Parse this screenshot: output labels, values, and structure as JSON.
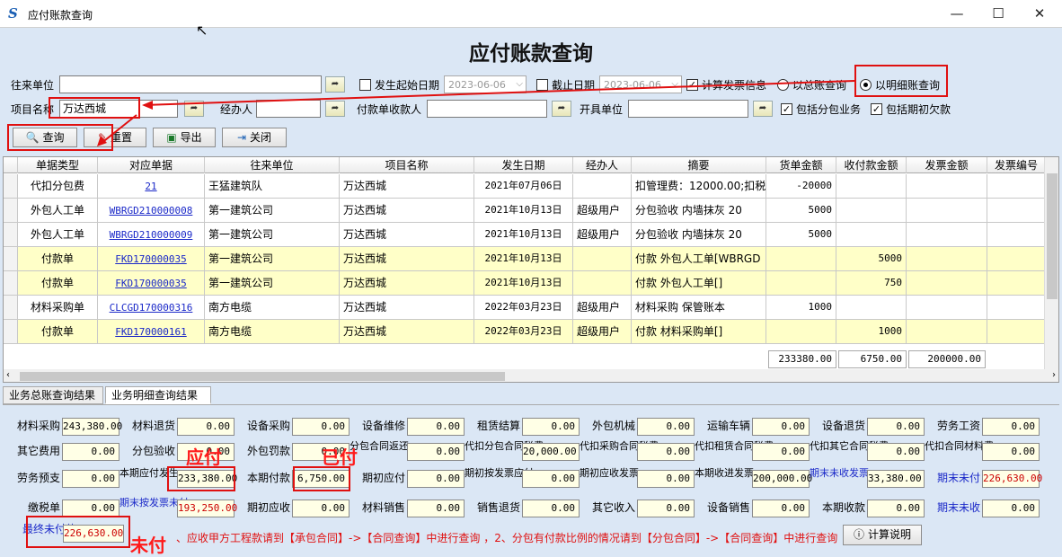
{
  "window": {
    "title": "应付账款查询",
    "heading": "应付账款查询"
  },
  "filters": {
    "partner_label": "往来单位",
    "partner_value": "",
    "start_date_label": "发生起始日期",
    "start_date": "2023-06-06",
    "start_checked": false,
    "end_date_label": "截止日期",
    "end_date": "2023-06-06",
    "end_checked": false,
    "calc_invoice_label": "计算发票信息",
    "calc_invoice_checked": true,
    "summary_radio_label": "以总账查询",
    "detail_radio_label": "以明细账查询",
    "mode": "detail",
    "project_label": "项目名称",
    "project_value": "万达西城",
    "handler_label": "经办人",
    "handler_value": "",
    "payee_label": "付款单收款人",
    "payee_value": "",
    "issuer_label": "开具单位",
    "issuer_value": "",
    "include_sub_label": "包括分包业务",
    "include_sub_checked": true,
    "include_opening_label": "包括期初欠款",
    "include_opening_checked": true
  },
  "buttons": {
    "query": "查询",
    "reset": "重置",
    "export": "导出",
    "close": "关闭",
    "calc_explain": "计算说明"
  },
  "table": {
    "columns": [
      "单据类型",
      "对应单据",
      "往来单位",
      "项目名称",
      "发生日期",
      "经办人",
      "摘要",
      "货单金额",
      "收付款金额",
      "发票金额",
      "发票编号"
    ],
    "rows": [
      {
        "type": "代扣分包费",
        "doc": "21",
        "partner": "王猛建筑队",
        "project": "万达西城",
        "date": "2021年07月06日",
        "handler": "",
        "summary": "扣管理费：12000.00;扣税",
        "goods": "-20000",
        "paid": "",
        "invoice": "",
        "hl": false
      },
      {
        "type": "外包人工单",
        "doc": "WBRGD210000008",
        "partner": "第一建筑公司",
        "project": "万达西城",
        "date": "2021年10月13日",
        "handler": "超级用户",
        "summary": "分包验收  内墙抹灰  20",
        "goods": "5000",
        "paid": "",
        "invoice": "",
        "hl": false
      },
      {
        "type": "外包人工单",
        "doc": "WBRGD210000009",
        "partner": "第一建筑公司",
        "project": "万达西城",
        "date": "2021年10月13日",
        "handler": "超级用户",
        "summary": "分包验收  内墙抹灰  20",
        "goods": "5000",
        "paid": "",
        "invoice": "",
        "hl": false
      },
      {
        "type": "付款单",
        "doc": "FKD170000035",
        "partner": "第一建筑公司",
        "project": "万达西城",
        "date": "2021年10月13日",
        "handler": "",
        "summary": "付款  外包人工单[WBRGD",
        "goods": "",
        "paid": "5000",
        "invoice": "",
        "hl": true
      },
      {
        "type": "付款单",
        "doc": "FKD170000035",
        "partner": "第一建筑公司",
        "project": "万达西城",
        "date": "2021年10月13日",
        "handler": "",
        "summary": "付款  外包人工单[]",
        "goods": "",
        "paid": "750",
        "invoice": "",
        "hl": true
      },
      {
        "type": "材料采购单",
        "doc": "CLCGD170000316",
        "partner": "南方电缆",
        "project": "万达西城",
        "date": "2022年03月23日",
        "handler": "超级用户",
        "summary": "材料采购  保管账本",
        "goods": "1000",
        "paid": "",
        "invoice": "",
        "hl": false
      },
      {
        "type": "付款单",
        "doc": "FKD170000161",
        "partner": "南方电缆",
        "project": "万达西城",
        "date": "2022年03月23日",
        "handler": "超级用户",
        "summary": "付款  材料采购单[]",
        "goods": "",
        "paid": "1000",
        "invoice": "",
        "hl": true
      }
    ],
    "totals": {
      "goods": "233380.00",
      "paid": "6750.00",
      "invoice": "200000.00"
    }
  },
  "tabs": [
    "业务总账查询结果",
    "业务明细查询结果"
  ],
  "summary": {
    "row1": [
      [
        "材料采购",
        "243,380.00"
      ],
      [
        "材料退货",
        "0.00"
      ],
      [
        "设备采购",
        "0.00"
      ],
      [
        "设备维修",
        "0.00"
      ],
      [
        "租赁结算",
        "0.00"
      ],
      [
        "外包机械",
        "0.00"
      ],
      [
        "运输车辆",
        "0.00"
      ],
      [
        "设备退货",
        "0.00"
      ],
      [
        "劳务工资",
        "0.00"
      ]
    ],
    "row2": [
      [
        "其它费用",
        "0.00"
      ],
      [
        "分包验收",
        "0.00"
      ],
      [
        "外包罚款",
        "0.00"
      ],
      [
        "分包合同返还",
        "0.00"
      ],
      [
        "代扣分包合同税费",
        "20,000.00"
      ],
      [
        "代扣采购合同税费",
        "0.00"
      ],
      [
        "代扣租赁合同税费",
        "0.00"
      ],
      [
        "代扣其它合同税费",
        "0.00"
      ],
      [
        "代扣合同材料费",
        "0.00"
      ]
    ],
    "row3": [
      [
        "劳务预支",
        "0.00"
      ],
      [
        "本期应付发生",
        "233,380.00"
      ],
      [
        "本期付款",
        "6,750.00"
      ],
      [
        "期初应付",
        "0.00"
      ],
      [
        "期初按发票应付",
        "0.00"
      ],
      [
        "期初应收发票",
        "0.00"
      ],
      [
        "本期收进发票",
        "200,000.00"
      ],
      [
        "期末未收发票",
        "33,380.00"
      ],
      [
        "期末未付",
        "226,630.00"
      ]
    ],
    "row4": [
      [
        "缴税单",
        "0.00"
      ],
      [
        "期末按发票未付",
        "193,250.00"
      ],
      [
        "期初应收",
        "0.00"
      ],
      [
        "材料销售",
        "0.00"
      ],
      [
        "销售退货",
        "0.00"
      ],
      [
        "其它收入",
        "0.00"
      ],
      [
        "设备销售",
        "0.00"
      ],
      [
        "本期收款",
        "0.00"
      ],
      [
        "期末未收",
        "0.00"
      ]
    ],
    "final_label": "最终未付款",
    "final_value": "226,630.00"
  },
  "annotations": {
    "yingfu": "应付",
    "yifu": "已付",
    "weifu": "未付"
  },
  "note": "、应收甲方工程款请到【承包合同】->【合同查询】中进行查询 ，2、分包有付款比例的情况请到【分包合同】->【合同查询】中进行查询",
  "colors": {
    "highlight_row": "#ffffc8",
    "link": "#1a28c8",
    "annotation": "#ff1a1a"
  }
}
